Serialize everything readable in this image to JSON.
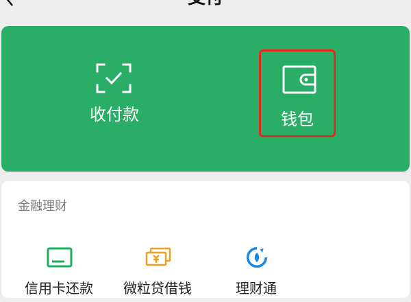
{
  "header": {
    "title": "支付",
    "back_icon": "chevron-left-icon"
  },
  "main_card": {
    "background": "#2aae67",
    "items": [
      {
        "label": "收付款",
        "icon": "scan-check-icon"
      },
      {
        "label": "钱包",
        "icon": "wallet-icon",
        "highlight_color": "#e8281e"
      }
    ]
  },
  "finance": {
    "title": "金融理财",
    "items": [
      {
        "label": "信用卡还款",
        "icon": "credit-card-icon"
      },
      {
        "label": "微粒贷借钱",
        "icon": "yuan-bills-icon"
      },
      {
        "label": "理财通",
        "icon": "licaitong-icon"
      }
    ]
  }
}
